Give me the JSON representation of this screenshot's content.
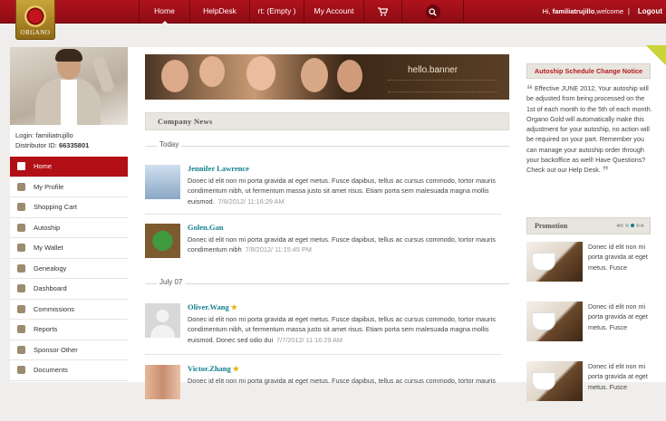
{
  "header": {
    "logo_text": "ORGANO",
    "nav": [
      {
        "label": "Home",
        "active": true
      },
      {
        "label": "HelpDesk",
        "active": false
      },
      {
        "label": "rt: (Empty )",
        "active": false
      },
      {
        "label": "My Account",
        "active": false
      }
    ],
    "cart_icon": "cart-icon",
    "search_icon": "search-icon",
    "greeting_prefix": "Hi, ",
    "username": "familiatrujillo",
    "greeting_suffix": ",welcome",
    "separator": "|",
    "logout": "Logout"
  },
  "profile": {
    "login_label": "Login: ",
    "login_value": "familiatrujillo",
    "distributor_label": "Distributor ID: ",
    "distributor_value": "66335801"
  },
  "sidebar": {
    "items": [
      {
        "label": "Home",
        "icon": "home-icon",
        "active": true
      },
      {
        "label": "My Profile",
        "icon": "profile-icon",
        "active": false
      },
      {
        "label": "Shopping Cart",
        "icon": "cart-icon",
        "active": false
      },
      {
        "label": "Autoship",
        "icon": "truck-icon",
        "active": false
      },
      {
        "label": "My Wallet",
        "icon": "wallet-icon",
        "active": false
      },
      {
        "label": "Genealogy",
        "icon": "tree-icon",
        "active": false
      },
      {
        "label": "Dashboard",
        "icon": "dashboard-icon",
        "active": false
      },
      {
        "label": "Commissions",
        "icon": "money-icon",
        "active": false
      },
      {
        "label": "Reports",
        "icon": "chart-icon",
        "active": false
      },
      {
        "label": "Sponsor Other",
        "icon": "person-icon",
        "active": false
      },
      {
        "label": "Documents",
        "icon": "document-icon",
        "active": false
      }
    ]
  },
  "banner": {
    "text": "hello.banner"
  },
  "company_news": {
    "title": "Company News",
    "groups": [
      {
        "label": "Today",
        "items": [
          {
            "name": "Jennifer Lawrence",
            "starred": false,
            "text": "Donec id elit non mi porta gravida at eget metus. Fusce dapibus, tellus ac cursus commodo, tortor mauris condimentum nibh, ut fermentum massa justo sit amet risus. Etiam porta sem malesuada magna mollis euismod.",
            "date": "7/8/2012/ 11:16:29 AM"
          },
          {
            "name": "Golen.Gan",
            "starred": false,
            "text": "Donec id elit non mi porta gravida at eget metus. Fusce dapibus, tellus ac cursus commodo, tortor mauris condimentum nibh",
            "date": "7/8/2012/ 11:15:45 PM"
          }
        ]
      },
      {
        "label": "July 07",
        "items": [
          {
            "name": "Oliver.Wang",
            "starred": true,
            "text": "Donec id elit non mi porta gravida at eget metus. Fusce dapibus, tellus ac cursus commodo, tortor mauris condimentum nibh, ut fermentum massa justo sit amet risus. Etiam porta sem malesuada magna mollis euismod. Donec sed odio dui",
            "date": "7/7/2012/ 11:16:29 AM"
          },
          {
            "name": "Victor.Zhang",
            "starred": true,
            "text": "Donec id elit non mi porta gravida at eget metus. Fusce dapibus, tellus ac cursus commodo, tortor mauris",
            "date": ""
          }
        ]
      }
    ]
  },
  "autoship_notice": {
    "title": "Autoship Schedule Change Notice",
    "body": "Effective JUNE 2012, Your autoship will be adjusted from being processed on the 1st of each month to the 5th of each month. Organo Gold will automatically make this adjustment for your autoship, no action will be required on your part. Remember you can manage your autoship order through your backoffice as well! Have Questions? Check out our Help Desk."
  },
  "promotion": {
    "title": "Promotion",
    "items": [
      {
        "text": "Donec id elit non mi porta gravida at eget metus. Fusce"
      },
      {
        "text": "Donec id elit non mi porta gravida at eget metus. Fusce"
      },
      {
        "text": "Donec id elit non mi porta gravida at eget metus. Fusce"
      }
    ]
  },
  "colors": {
    "brand_red": "#b20f17",
    "link_teal": "#127f8e",
    "gold": "#caa43a"
  }
}
